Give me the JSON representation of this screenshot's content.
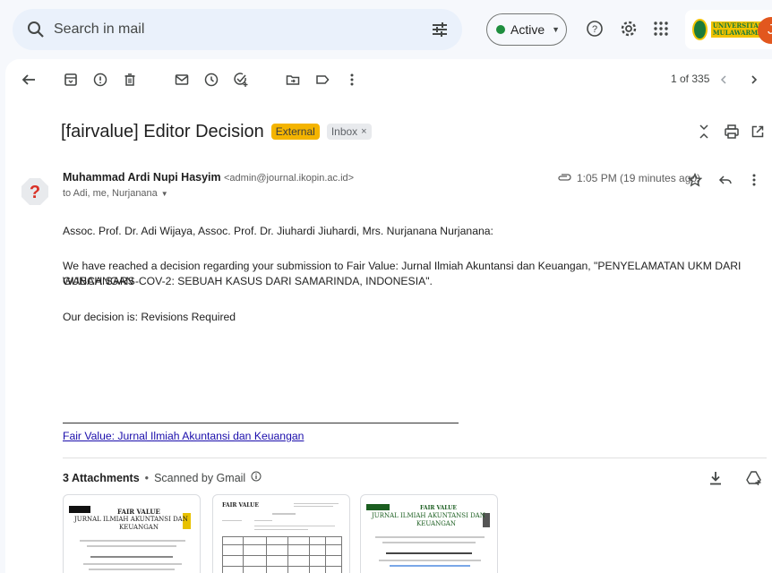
{
  "search": {
    "placeholder": "Search in mail"
  },
  "status": {
    "label": "Active",
    "color": "#1e8e3e"
  },
  "brand": {
    "text": "UNIVERSITAS MULAWARMAN"
  },
  "account": {
    "initial": "J",
    "color": "#e2571e"
  },
  "toolbar": {
    "icons": [
      "back-arrow-icon",
      "archive-icon",
      "report-spam-icon",
      "delete-icon",
      "mark-unread-icon",
      "snooze-icon",
      "add-to-tasks-icon",
      "move-to-icon",
      "label-icon",
      "more-icon"
    ],
    "pager": "1 of 335"
  },
  "email": {
    "subject": "[fairvalue] Editor Decision",
    "labels": {
      "external": "External",
      "inbox": "Inbox",
      "inbox_close": "×"
    },
    "sender_name": "Muhammad Ardi Nupi Hasyim",
    "sender_email": "<admin@journal.ikopin.ac.id>",
    "to": "to Adi, me, Nurjanana",
    "time": "1:05 PM (19 minutes ago)",
    "body": {
      "greeting": "Assoc. Prof. Dr. Adi Wijaya, Assoc. Prof. Dr. Jiuhardi Jiuhardi, Mrs. Nurjanana Nurjanana:",
      "paragraph_line1": "We have reached a decision regarding your submission to Fair Value: Jurnal Ilmiah Akuntansi dan Keuangan, \"PENYELAMATAN UKM DARI GUNCANGAN",
      "paragraph_line2": "WABAH SARS-COV-2: SEBUAH KASUS DARI SAMARINDA, INDONESIA\".",
      "decision": "Our decision is: Revisions Required"
    },
    "signature_link": "Fair Value: Jurnal Ilmiah Akuntansi dan Keuangan"
  },
  "attachments": {
    "count_label": "3 Attachments",
    "separator": "•",
    "scan_label": "Scanned by Gmail",
    "thumbs": [
      {
        "title": "FAIR VALUE",
        "subtitle": "JURNAL ILMIAH AKUNTANSI DAN",
        "subtitle2": "KEUANGAN"
      },
      {
        "title": "FAIR VALUE",
        "subtitle": "",
        "subtitle2": ""
      },
      {
        "title": "FAIR VALUE",
        "subtitle": "JURNAL ILMIAH AKUNTANSI DAN",
        "subtitle2": "KEUANGAN"
      }
    ]
  }
}
